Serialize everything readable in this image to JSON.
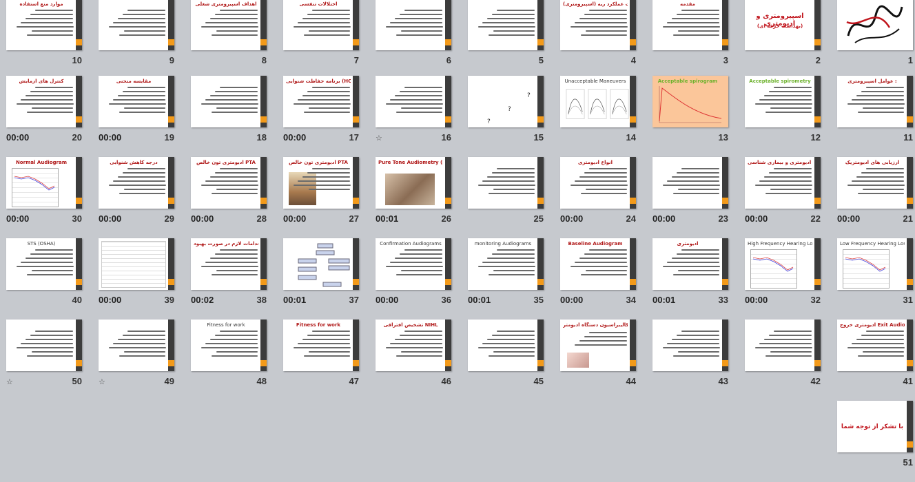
{
  "slides": [
    {
      "number": "1",
      "title": "",
      "kind": "calligraphy",
      "time": "",
      "star": false
    },
    {
      "number": "2",
      "title": "اسپیرومتری و ادیومتری",
      "subtitle": "(بهداشت حرفه ای)",
      "kind": "title",
      "time": "",
      "star": false
    },
    {
      "number": "3",
      "title": "مقدمه",
      "kind": "text",
      "time": "",
      "star": false
    },
    {
      "number": "4",
      "title": "تست عملکرد ریه (اسپیرومتری)",
      "kind": "text",
      "time": "",
      "star": false
    },
    {
      "number": "5",
      "title": "",
      "kind": "text",
      "time": "",
      "star": false
    },
    {
      "number": "6",
      "title": "",
      "kind": "text",
      "time": "",
      "star": false
    },
    {
      "number": "7",
      "title": "اختلالات تنفسی",
      "kind": "text",
      "time": "",
      "star": false
    },
    {
      "number": "8",
      "title": "اهداف اسپیرومتری شغلی",
      "kind": "text",
      "time": "",
      "star": false
    },
    {
      "number": "9",
      "title": "",
      "kind": "text",
      "time": "",
      "star": false
    },
    {
      "number": "10",
      "title": "موارد منع استفاده",
      "kind": "text",
      "time": "",
      "star": false
    },
    {
      "number": "11",
      "title": "عوامل اسپیرومتری :",
      "kind": "text",
      "time": "",
      "star": false
    },
    {
      "number": "12",
      "title": "Acceptable spirometry",
      "kind": "text-green",
      "time": "",
      "star": false
    },
    {
      "number": "13",
      "title": "Acceptable spirogram",
      "kind": "spirogram",
      "time": "",
      "star": false
    },
    {
      "number": "14",
      "title": "Unacceptable Maneuvers",
      "kind": "maneuvers",
      "time": "",
      "star": false
    },
    {
      "number": "15",
      "title": "",
      "kind": "question",
      "time": "",
      "star": false
    },
    {
      "number": "16",
      "title": "",
      "kind": "text",
      "time": "",
      "star": true
    },
    {
      "number": "17",
      "title": "برنامه حفاظت شنوایی (HCP)",
      "kind": "text",
      "time": "00:00",
      "star": false
    },
    {
      "number": "18",
      "title": "",
      "kind": "text",
      "time": "",
      "star": false
    },
    {
      "number": "19",
      "title": "مقایسه منحنی",
      "kind": "text",
      "time": "00:00",
      "star": false
    },
    {
      "number": "20",
      "title": "کنترل های آزمایش",
      "kind": "text",
      "time": "00:00",
      "star": false
    },
    {
      "number": "21",
      "title": "ارزیابی های ادیومتریک",
      "kind": "text",
      "time": "00:00",
      "star": false
    },
    {
      "number": "22",
      "title": "اهداف ادیومتری و بیماری شناسی",
      "kind": "text",
      "time": "00:00",
      "star": false
    },
    {
      "number": "23",
      "title": "",
      "kind": "text",
      "time": "00:00",
      "star": false
    },
    {
      "number": "24",
      "title": "انواع ادیومتری",
      "kind": "text",
      "time": "00:00",
      "star": false
    },
    {
      "number": "25",
      "title": "",
      "kind": "text",
      "time": "",
      "star": false
    },
    {
      "number": "26",
      "title": "Pure Tone Audiometry (PTA)",
      "kind": "photo",
      "time": "00:01",
      "star": false
    },
    {
      "number": "27",
      "title": "ادیومتری تون خالص PTA",
      "kind": "photo-small",
      "time": "00:00",
      "star": false
    },
    {
      "number": "28",
      "title": "ادیومتری تون خالص PTA",
      "kind": "text",
      "time": "00:00",
      "star": false
    },
    {
      "number": "29",
      "title": "درجه کاهش شنوایی",
      "kind": "text",
      "time": "00:00",
      "star": false
    },
    {
      "number": "30",
      "title": "Normal Audiogram",
      "kind": "audiogram",
      "time": "00:00",
      "star": false
    },
    {
      "number": "31",
      "title": "Low Frequency Hearing Loss",
      "kind": "audiogram-dark",
      "time": "",
      "star": false
    },
    {
      "number": "32",
      "title": "High Frequency Hearing Loss",
      "kind": "audiogram-dark",
      "time": "00:00",
      "star": false
    },
    {
      "number": "33",
      "title": "ادیومتری",
      "kind": "text",
      "time": "00:01",
      "star": false
    },
    {
      "number": "34",
      "title": "Baseline Audiogram",
      "kind": "text",
      "time": "00:00",
      "star": false
    },
    {
      "number": "35",
      "title": "monitoring Audiograms",
      "kind": "text-dark",
      "time": "00:01",
      "star": false
    },
    {
      "number": "36",
      "title": "Confirmation Audiograms",
      "kind": "text-dark",
      "time": "00:00",
      "star": false
    },
    {
      "number": "37",
      "title": "",
      "kind": "flow",
      "time": "00:01",
      "star": false
    },
    {
      "number": "38",
      "title": "اقدامات لازم در صورت بهبود STS",
      "kind": "text",
      "time": "00:02",
      "star": false
    },
    {
      "number": "39",
      "title": "",
      "kind": "form",
      "time": "00:00",
      "star": false
    },
    {
      "number": "40",
      "title": "STS (OSHA)",
      "kind": "text-dark",
      "time": "",
      "star": false
    },
    {
      "number": "41",
      "title": "ادیومتری خروج Exit Audiogram",
      "kind": "text",
      "time": "",
      "star": false
    },
    {
      "number": "42",
      "title": "",
      "kind": "text",
      "time": "",
      "star": false
    },
    {
      "number": "43",
      "title": "",
      "kind": "text",
      "time": "",
      "star": false
    },
    {
      "number": "44",
      "title": "کالیبراسیون دستگاه ادیومتر",
      "kind": "device",
      "time": "",
      "star": false
    },
    {
      "number": "45",
      "title": "",
      "kind": "text",
      "time": "",
      "star": false
    },
    {
      "number": "46",
      "title": "تشخیص افتراقی NIHL",
      "kind": "text",
      "time": "",
      "star": false
    },
    {
      "number": "47",
      "title": "Fitness for work",
      "kind": "text",
      "time": "",
      "star": false
    },
    {
      "number": "48",
      "title": "Fitness for work",
      "kind": "text-dark",
      "time": "",
      "star": false
    },
    {
      "number": "49",
      "title": "",
      "kind": "text",
      "time": "",
      "star": true
    },
    {
      "number": "50",
      "title": "",
      "kind": "text",
      "time": "",
      "star": true
    },
    {
      "number": "51",
      "title": "با تشکر از توجه شما",
      "kind": "thanks",
      "time": "",
      "star": false
    }
  ],
  "colors": {
    "background": "#c6c9ce",
    "accent": "#f39a1a",
    "title": "#b01818"
  }
}
